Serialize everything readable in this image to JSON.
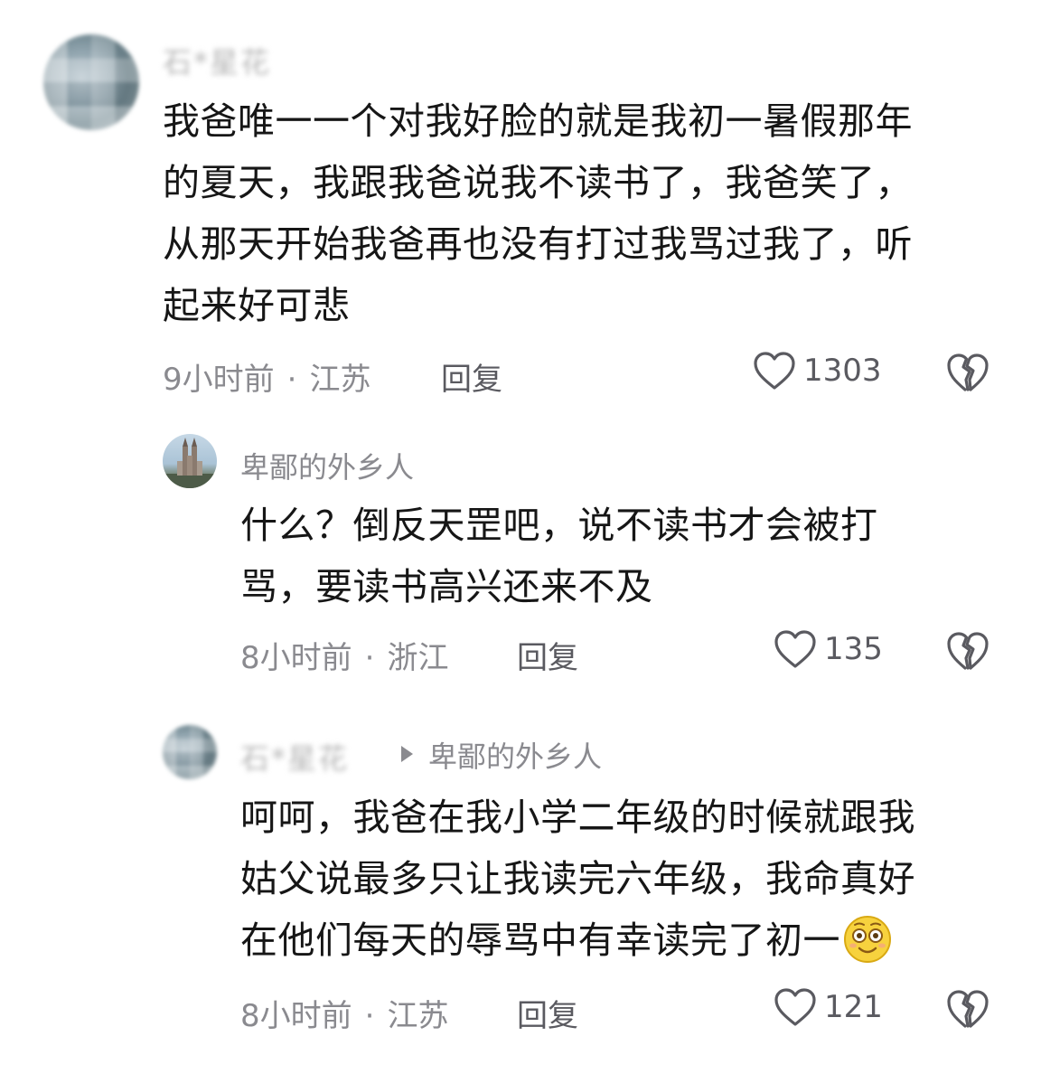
{
  "comments": [
    {
      "username": "石*星花",
      "text": "我爸唯一一个对我好脸的就是我初一暑假那年\n的夏天，我跟我爸说我不读书了，我爸笑了，\n从那天开始我爸再也没有打过我骂过我了，听\n起来好可悲",
      "time": "9小时前",
      "location": "江苏",
      "reply_label": "回复",
      "likes": "1303"
    },
    {
      "username": "卑鄙的外乡人",
      "text": "什么？倒反天罡吧，说不读书才会被打\n骂，要读书高兴还来不及",
      "time": "8小时前",
      "location": "浙江",
      "reply_label": "回复",
      "likes": "135"
    },
    {
      "username": "石*星花",
      "reply_to": "卑鄙的外乡人",
      "text": "呵呵，我爸在我小学二年级的时候就跟我\n姑父说最多只让我读完六年级，我命真好\n在他们每天的辱骂中有幸读完了初一",
      "time": "8小时前",
      "location": "江苏",
      "reply_label": "回复",
      "likes": "121",
      "emoji": "smiling-face-emoji"
    }
  ],
  "separator": "·",
  "icons": {
    "like": "heart-outline-icon",
    "dislike": "broken-heart-icon",
    "reply_arrow": "triangle-right-icon"
  }
}
